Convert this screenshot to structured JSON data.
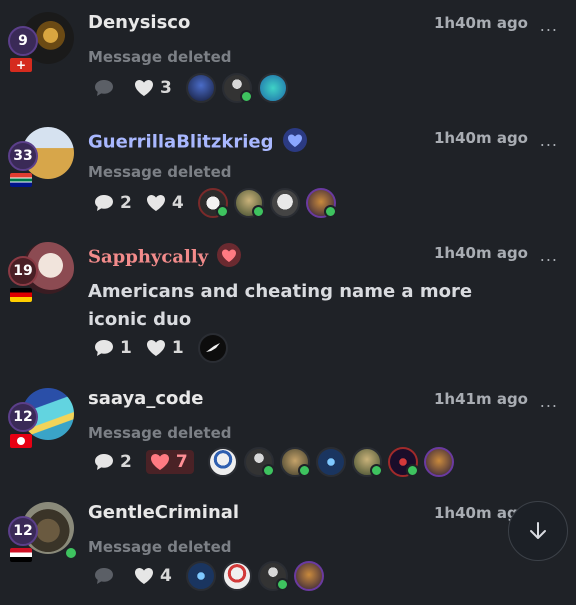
{
  "posts": [
    {
      "username": "Denysisco",
      "level": "9",
      "time": "1h40m ago",
      "more": "...",
      "message": "Message deleted",
      "deleted": true,
      "comments": "",
      "likes": "3",
      "flag": "switzerland"
    },
    {
      "username": "GuerrillaBlitzkrieg",
      "name_color": "#a9b8ff",
      "level": "33",
      "time": "1h40m ago",
      "more": "...",
      "message": "Message deleted",
      "deleted": true,
      "comments": "2",
      "likes": "4",
      "flag": "south-africa"
    },
    {
      "username": "Sapphycally",
      "name_color": "#f28b8b",
      "level": "19",
      "time": "1h40m ago",
      "more": "...",
      "message": "Americans and cheating name a more iconic duo",
      "deleted": false,
      "comments": "1",
      "likes": "1",
      "flag": "germany"
    },
    {
      "username": "saaya_code",
      "level": "12",
      "time": "1h41m ago",
      "more": "...",
      "message": "Message deleted",
      "deleted": true,
      "comments": "2",
      "likes": "7",
      "liked": true,
      "flag": "tunisia"
    },
    {
      "username": "GentleCriminal",
      "level": "12",
      "time": "1h40m ago",
      "more": "...",
      "message": "Message deleted",
      "deleted": true,
      "comments": "",
      "likes": "4",
      "flag": "egypt"
    }
  ],
  "colors": {
    "background": "#1f2227",
    "online": "#3ec35f",
    "level_bg": "#3a2a57",
    "liked_bg": "#4a2226",
    "liked_text": "#ff8f95"
  },
  "scroll_button_icon": "arrow-down-icon"
}
